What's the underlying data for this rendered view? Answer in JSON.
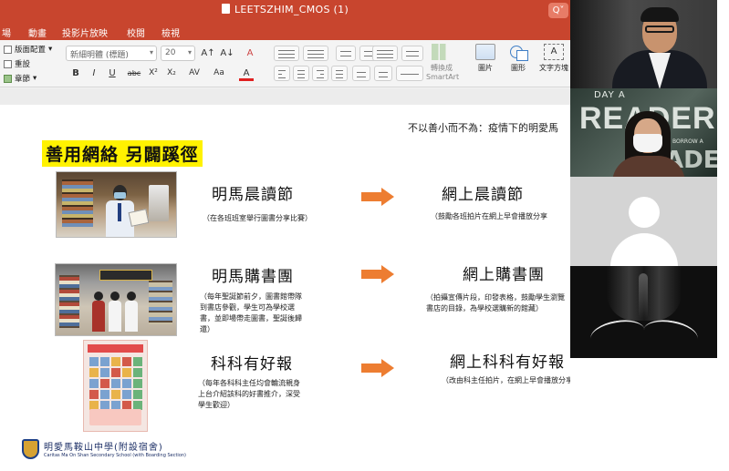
{
  "app": {
    "document_title": "LEETSZHIM_CMOS (1)",
    "search_glyph": "Q˅"
  },
  "menubar": {
    "items": [
      "場",
      "動畫",
      "投影片放映",
      "校閱",
      "檢視"
    ]
  },
  "ribbon": {
    "layout_label": "版面配置",
    "reset_label": "重設",
    "section_label": "章節",
    "font_name": "新細明體 (標題)",
    "font_size": "20",
    "bold": "B",
    "italic": "I",
    "underline": "U",
    "strike": "abc",
    "superscript": "X²",
    "subscript": "X₂",
    "char_spacing": "AV",
    "change_case": "Aa",
    "font_color": "A",
    "grow_font": "A↑",
    "shrink_font": "A↓",
    "clear_format": "A",
    "convert_smartart": "轉換成",
    "smartart_suffix": "SmartArt",
    "picture": "圖片",
    "shapes": "圖形",
    "textbox": "文字方塊",
    "textbox_glyph": "A"
  },
  "slide": {
    "top_title": "不以善小而不為：疫情下的明愛馬",
    "main_title": "善用網絡 另闢蹊徑",
    "rows": [
      {
        "left_title": "明馬晨讀節",
        "left_desc": "（在各班班室舉行圖書分享比賽）",
        "right_title": "網上晨讀節",
        "right_desc": "（鼓勵各班拍片在網上早會播放分享"
      },
      {
        "left_title": "明馬購書團",
        "left_desc": "（每年聖誕節前夕，圖書館帶隊到書店參觀，學生可為學校選書，並即場帶走圖書，聖誕後歸還）",
        "right_title": "網上購書團",
        "right_desc": "（拍攝宣傳片段，印發表格，鼓勵學生瀏覽書店的目錄，為學校選購新的館藏）"
      },
      {
        "left_title": "科科有好報",
        "left_desc": "（每年各科科主任均會輪流親身上台介紹該科的好書推介，深受學生歡迎）",
        "right_title": "網上科科有好報",
        "right_desc": "（改由科主任拍片，在網上早會播放分享）"
      }
    ],
    "school_name_zh": "明愛馬鞍山中學(附設宿舍)",
    "school_name_en": "Caritas Ma On Shan Secondary School (with Boarding Section)"
  },
  "video": {
    "t2_sign_top": "DAY A",
    "t2_sign_main": "READER",
    "t2_sign_mid": "BORROW A",
    "t2_sign_bottom": "ADER"
  },
  "colors": {
    "titlebar": "#c8452e",
    "title_highlight": "#fff200",
    "arrow": "#ed7d31"
  }
}
